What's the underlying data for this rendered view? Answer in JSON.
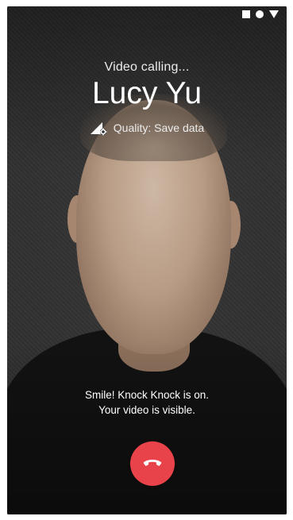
{
  "status_bar": {
    "icons": [
      "stop-square-icon",
      "record-circle-icon",
      "signal-triangle-icon"
    ]
  },
  "call": {
    "status": "Video calling...",
    "caller_name": "Lucy Yu",
    "quality_label": "Quality: Save data",
    "quality_icon": "signal-settings-icon"
  },
  "knock_knock": {
    "line1": "Smile! Knock Knock is on.",
    "line2": "Your video is visible."
  },
  "end_call": {
    "icon": "hang-up-icon",
    "color": "#e8434a"
  }
}
